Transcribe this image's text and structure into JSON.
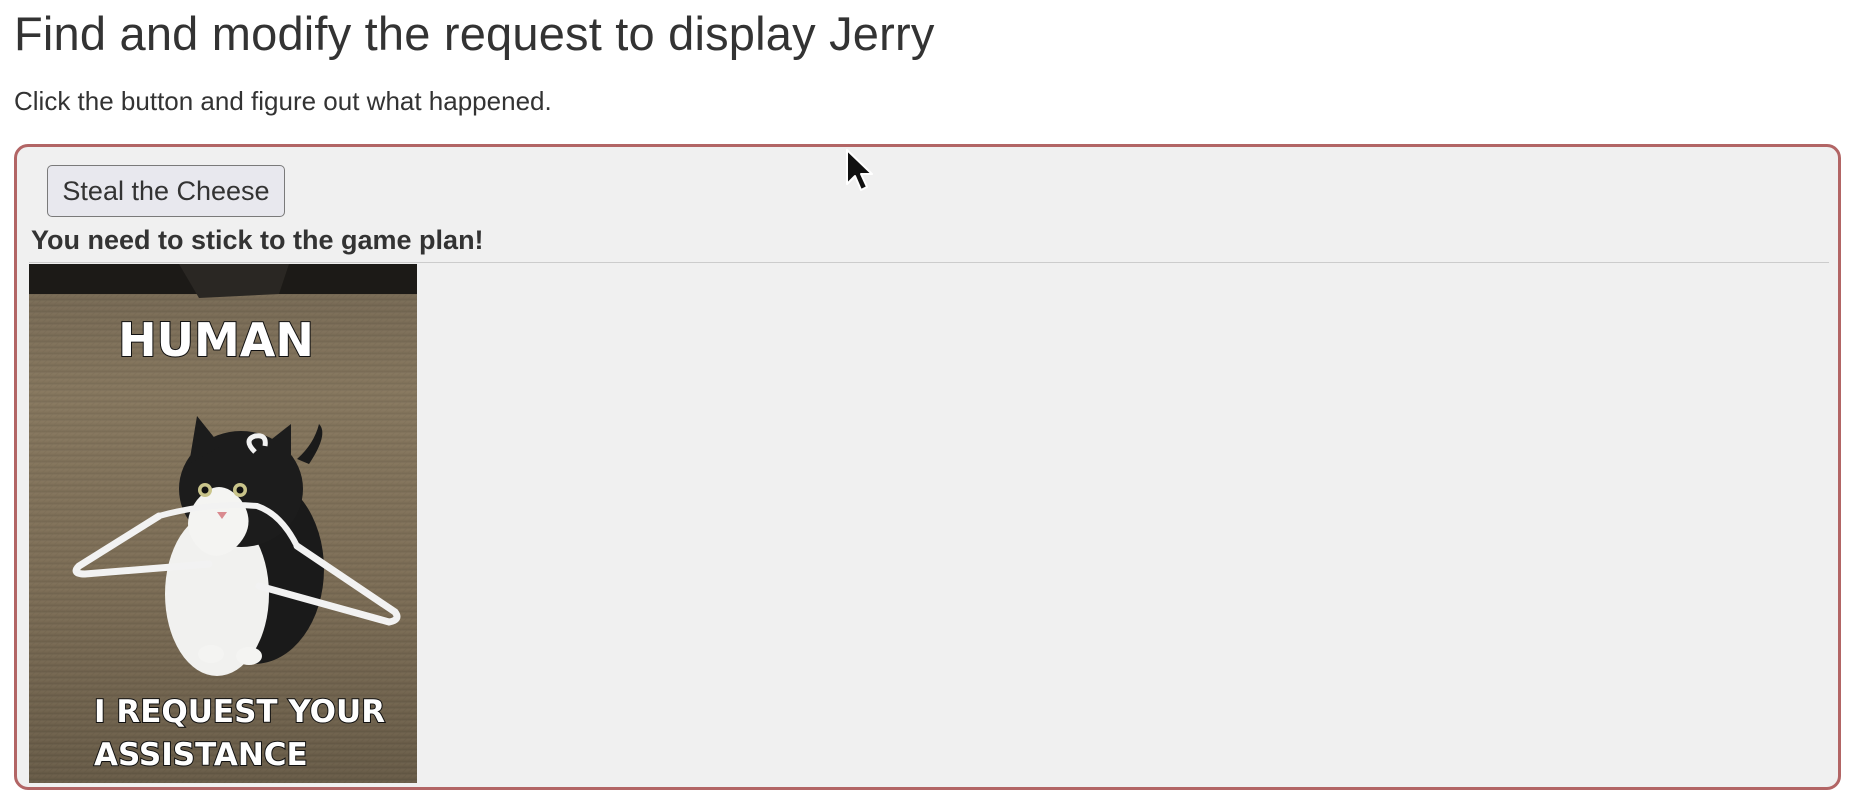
{
  "page": {
    "title": "Find and modify the request to display Jerry",
    "subtitle": "Click the button and figure out what happened."
  },
  "challenge": {
    "button_label": "Steal the Cheese",
    "message": "You need to stick to the game plan!",
    "image": {
      "top_caption": "HUMAN",
      "bottom_caption_line1": "I REQUEST YOUR",
      "bottom_caption_line2": "ASSISTANCE"
    }
  },
  "colors": {
    "panel_border": "#b26565",
    "panel_background": "#f0f0f0",
    "text": "#333333"
  },
  "icons": {
    "cursor": "mouse-pointer-icon"
  }
}
